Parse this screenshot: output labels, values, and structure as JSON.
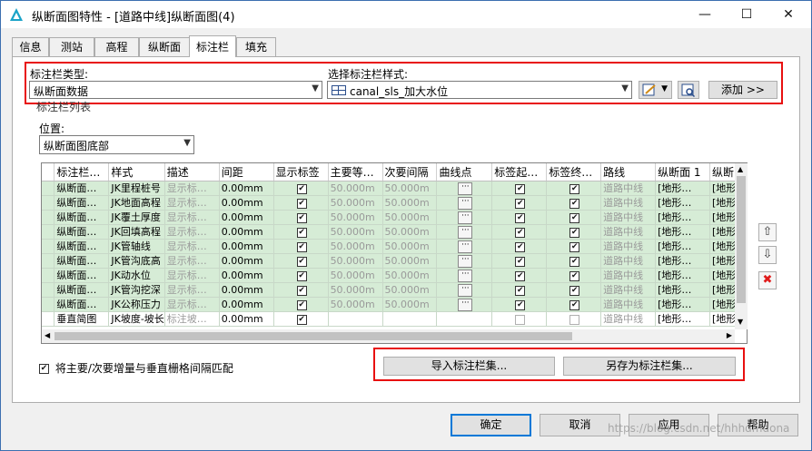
{
  "window": {
    "title": "纵断面图特性 - [道路中线]纵断面图(4)",
    "minimize_glyph": "—",
    "maximize_glyph": "☐",
    "close_glyph": "✕",
    "accent": "#0078d7"
  },
  "tabs": [
    "信息",
    "测站",
    "高程",
    "纵断面",
    "标注栏",
    "填充"
  ],
  "active_tab": "标注栏",
  "band_type": {
    "label": "标注栏类型:",
    "value": "纵断面数据"
  },
  "band_style": {
    "label": "选择标注栏样式:",
    "value": "canal_sls_加大水位"
  },
  "add_button": "添加 >>",
  "band_list": {
    "label": "标注栏列表",
    "position_label": "位置:",
    "position_value": "纵断面图底部",
    "columns": [
      "标注栏…",
      "样式",
      "描述",
      "间距",
      "显示标签",
      "主要等…",
      "次要间隔",
      "曲线点",
      "标签起…",
      "标签终…",
      "路线",
      "纵断面 1",
      "纵断"
    ],
    "rows": [
      {
        "type": "纵断面…",
        "style": "JK里程桩号",
        "desc": "显示标…",
        "gap": "0.00mm",
        "show": true,
        "major": "50.000m",
        "minor": "50.000m",
        "start": true,
        "end": true,
        "alignment": "道路中线",
        "p1": "[地形…",
        "p2": "[地形"
      },
      {
        "type": "纵断面…",
        "style": "JK地面高程",
        "desc": "显示标…",
        "gap": "0.00mm",
        "show": true,
        "major": "50.000m",
        "minor": "50.000m",
        "start": true,
        "end": true,
        "alignment": "道路中线",
        "p1": "[地形…",
        "p2": "[地形"
      },
      {
        "type": "纵断面…",
        "style": "JK覆土厚度",
        "desc": "显示标…",
        "gap": "0.00mm",
        "show": true,
        "major": "50.000m",
        "minor": "50.000m",
        "start": true,
        "end": true,
        "alignment": "道路中线",
        "p1": "[地形…",
        "p2": "[地形"
      },
      {
        "type": "纵断面…",
        "style": "JK回填高程",
        "desc": "显示标…",
        "gap": "0.00mm",
        "show": true,
        "major": "50.000m",
        "minor": "50.000m",
        "start": true,
        "end": true,
        "alignment": "道路中线",
        "p1": "[地形…",
        "p2": "[地形"
      },
      {
        "type": "纵断面…",
        "style": "JK管轴线",
        "desc": "显示标…",
        "gap": "0.00mm",
        "show": true,
        "major": "50.000m",
        "minor": "50.000m",
        "start": true,
        "end": true,
        "alignment": "道路中线",
        "p1": "[地形…",
        "p2": "[地形"
      },
      {
        "type": "纵断面…",
        "style": "JK管沟底高",
        "desc": "显示标…",
        "gap": "0.00mm",
        "show": true,
        "major": "50.000m",
        "minor": "50.000m",
        "start": true,
        "end": true,
        "alignment": "道路中线",
        "p1": "[地形…",
        "p2": "[地形"
      },
      {
        "type": "纵断面…",
        "style": "JK动水位",
        "desc": "显示标…",
        "gap": "0.00mm",
        "show": true,
        "major": "50.000m",
        "minor": "50.000m",
        "start": true,
        "end": true,
        "alignment": "道路中线",
        "p1": "[地形…",
        "p2": "[地形"
      },
      {
        "type": "纵断面…",
        "style": "JK管沟挖深",
        "desc": "显示标…",
        "gap": "0.00mm",
        "show": true,
        "major": "50.000m",
        "minor": "50.000m",
        "start": true,
        "end": true,
        "alignment": "道路中线",
        "p1": "[地形…",
        "p2": "[地形"
      },
      {
        "type": "纵断面…",
        "style": "JK公称压力",
        "desc": "显示标…",
        "gap": "0.00mm",
        "show": true,
        "major": "50.000m",
        "minor": "50.000m",
        "start": true,
        "end": true,
        "alignment": "道路中线",
        "p1": "[地形…",
        "p2": "[地形"
      },
      {
        "type": "垂直简图",
        "style": "JK坡度-坡长",
        "desc": "标注坡…",
        "gap": "0.00mm",
        "show": true,
        "major": "",
        "minor": "",
        "start": false,
        "end": false,
        "alignment": "道路中线",
        "p1": "[地形…",
        "p2": "[地形"
      }
    ]
  },
  "match_checkbox": {
    "label": "将主要/次要增量与垂直栅格间隔匹配",
    "checked": true
  },
  "import_button": "导入标注栏集...",
  "save_as_button": "另存为标注栏集...",
  "footer": {
    "ok": "确定",
    "cancel": "取消",
    "apply": "应用",
    "help": "帮助"
  },
  "watermark": "https://blog.csdn.net/hhhdmdona"
}
